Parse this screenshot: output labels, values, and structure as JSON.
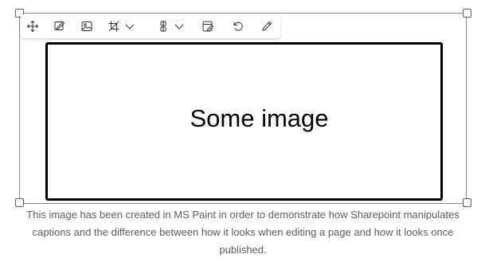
{
  "image": {
    "text": "Some image"
  },
  "caption": {
    "text": "This image has been created in MS Paint in order to demonstrate how Sharepoint manipulates captions and the difference between how it looks when editing a page and how it looks once published."
  },
  "toolbar": {
    "buttons": [
      {
        "name": "move-icon"
      },
      {
        "name": "edit-image-icon"
      },
      {
        "name": "replace-image-icon"
      },
      {
        "name": "crop-icon",
        "has_dropdown": true
      },
      {
        "name": "align-icon",
        "has_dropdown": true
      },
      {
        "name": "alt-text-icon"
      },
      {
        "name": "reset-icon"
      },
      {
        "name": "edit-pencil-icon"
      }
    ]
  },
  "colors": {
    "frame_border": "#8a8886",
    "caption_text": "#605e5c",
    "icon": "#323130"
  }
}
